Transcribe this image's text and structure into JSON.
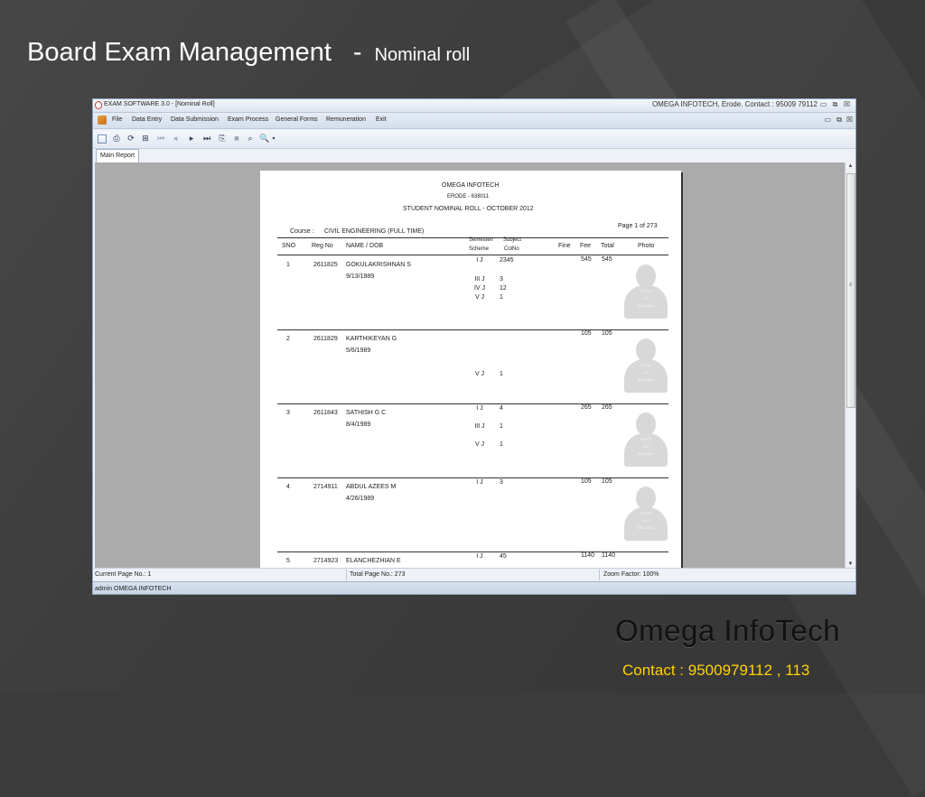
{
  "slide": {
    "title": "Board Exam Management",
    "dash": "-",
    "subtitle": "Nominal roll",
    "brand": "Omega  InfoTech",
    "contact": "Contact : 9500979112 , 113"
  },
  "window": {
    "title": "EXAM SOFTWARE 3.0 - [Nominal Roll]",
    "right_title": "OMEGA INFOTECH, Erode. Contact : 95009 79112",
    "menu": [
      "File",
      "Data Entry",
      "Data Submission",
      "Exam Process",
      "General Forms",
      "Remuneration",
      "Exit"
    ],
    "tab": "Main Report",
    "status": {
      "current_page": "Current Page No.: 1",
      "total_page": "Total Page No.: 273",
      "zoom": "Zoom Factor: 100%"
    },
    "user": "admin  OMEGA INFOTECH"
  },
  "report": {
    "org": "OMEGA INFOTECH",
    "city": "ERODE - 638011",
    "title": "STUDENT NOMINAL ROLL - OCTOBER 2012",
    "page_info": "Page 1 of 273",
    "course_label": "Course  :",
    "course": "CIVIL ENGINEERING (FULL TIME)",
    "headers": {
      "sno": "SNO",
      "regno": "Reg No",
      "name": "NAME   /  DOB",
      "semester": "Semester/",
      "scheme": "Scheme",
      "subject": "Subject",
      "colno": "ColNo",
      "fine": "Fine",
      "fee": "Fee",
      "total": "Total",
      "photo": "Photo"
    },
    "photo_text": [
      "PHOTO",
      "NOT",
      "AVAILABLE"
    ],
    "students": [
      {
        "sno": "1",
        "regno": "2611825",
        "name": "GOKULAKRISHNAN  S",
        "dob": "9/13/1989",
        "subjects": [
          [
            "I  J",
            "2345"
          ],
          [
            "III  J",
            "3"
          ],
          [
            "IV  J",
            "12"
          ],
          [
            "V  J",
            "1"
          ]
        ],
        "fee": "545",
        "total": "545"
      },
      {
        "sno": "2",
        "regno": "2611829",
        "name": "KARTHIKEYAN  G",
        "dob": "5/6/1989",
        "subjects": [
          [
            "V  J",
            "1"
          ]
        ],
        "fee": "105",
        "total": "105"
      },
      {
        "sno": "3",
        "regno": "2611843",
        "name": "SATHISH  G C",
        "dob": "8/4/1989",
        "subjects": [
          [
            "I  J",
            "4"
          ],
          [
            "III  J",
            "1"
          ],
          [
            "V  J",
            "1"
          ]
        ],
        "fee": "265",
        "total": "265"
      },
      {
        "sno": "4",
        "regno": "2714911",
        "name": "ABDUL AZEES  M",
        "dob": "4/26/1989",
        "subjects": [
          [
            "I  J",
            "3"
          ]
        ],
        "fee": "105",
        "total": "105"
      },
      {
        "sno": "5",
        "regno": "2714923",
        "name": "ELANCHEZHIAN E",
        "dob": "",
        "subjects": [
          [
            "I  J",
            "45"
          ]
        ],
        "fee": "1140",
        "total": "1140"
      }
    ]
  }
}
